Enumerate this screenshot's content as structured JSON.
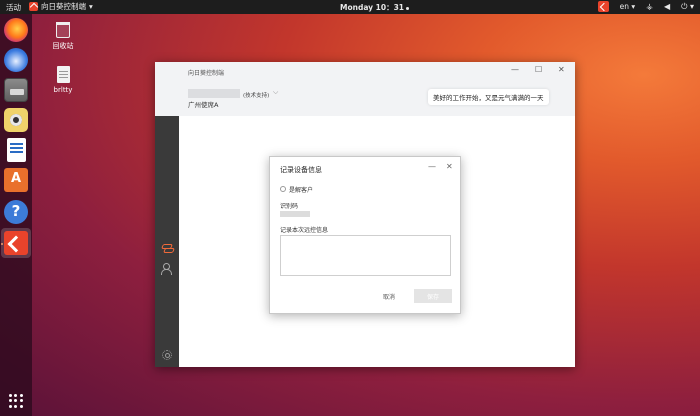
{
  "topbar": {
    "activities": "活动",
    "app_name": "向日葵控制端",
    "app_menu_arrow": "▾",
    "clock": "Monday 10：31",
    "language": "en",
    "language_arrow": "▾",
    "network_glyph": "⚶",
    "volume_glyph": "◀",
    "power_glyph": "⏻",
    "power_arrow": "▾"
  },
  "desktop": {
    "icons": [
      {
        "label": "回收站"
      },
      {
        "label": "brltty"
      }
    ]
  },
  "app": {
    "title": "向日葵控制端",
    "minimize_glyph": "—",
    "maximize_glyph": "☐",
    "close_glyph": "✕",
    "device_subtitle": "(技术支持)",
    "device_chevron": "⌵",
    "device_name": "广州使席A",
    "greeting": "美好的工作开始，又是元气满满的一天"
  },
  "dialog": {
    "title": "记录设备信息",
    "minimize_glyph": "—",
    "close_glyph": "✕",
    "checkbox_label": "是解客户",
    "id_label": "识别码",
    "note_label": "记录本次远控信息",
    "note_value": "",
    "cancel_label": "取消",
    "save_label": "保存"
  },
  "colors": {
    "accent": "#e9432b",
    "sidebar": "#3a3a3a",
    "header": "#f2f3f5"
  }
}
